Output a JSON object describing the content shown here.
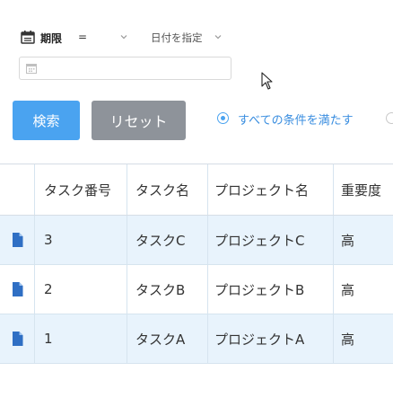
{
  "filter": {
    "label": "期限",
    "operator": "=",
    "mode": "日付を指定",
    "date_value": "",
    "icon": "calendar-icon"
  },
  "buttons": {
    "search": "検索",
    "reset": "リセット"
  },
  "match": {
    "all_label": "すべての条件を満たす",
    "selected": "all"
  },
  "table": {
    "columns": [
      "タスク番号",
      "タスク名",
      "プロジェクト名",
      "重要度"
    ],
    "rows": [
      {
        "no": "3",
        "name": "タスクC",
        "project": "プロジェクトC",
        "priority": "高"
      },
      {
        "no": "2",
        "name": "タスクB",
        "project": "プロジェクトB",
        "priority": "高"
      },
      {
        "no": "1",
        "name": "タスクA",
        "project": "プロジェクトA",
        "priority": "高"
      }
    ]
  },
  "colors": {
    "accent": "#4aa3f0",
    "reset_button": "#8e939a",
    "row_highlight": "#e8f3fc",
    "doc_icon": "#2f6fc4"
  }
}
